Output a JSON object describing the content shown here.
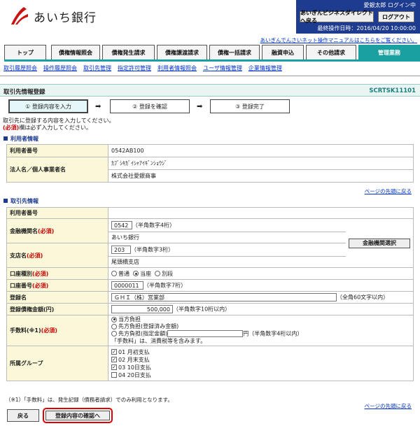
{
  "header": {
    "bank_name": "あいち銀行",
    "user": "愛銀太郎 ログイン中",
    "direct_button": "あいぎんビジネスダイレクトへ戻る",
    "logout_button": "ログアウト",
    "last_operation": "最終操作日時：2016/04/20 10:00:00",
    "manual_link": "あいぎんでんさいネット操作マニュアルはこちらをご覧ください。"
  },
  "tabs": [
    "トップ",
    "債権情報照会",
    "債権発生請求",
    "債権譲渡請求",
    "債権一括請求",
    "融資申込",
    "その他請求",
    "管理業務"
  ],
  "subnav": [
    "取引履歴照会",
    "操作履歴照会",
    "取引先管理",
    "指定許可管理",
    "利用者情報照会",
    "ユーザ情報管理",
    "企業情報管理"
  ],
  "title": {
    "text": "取引先情報登録",
    "code": "SCRTSK11101"
  },
  "steps": [
    "① 登録内容を入力",
    "② 登録を確認",
    "③ 登録完了"
  ],
  "intro": {
    "line1": "取引先に登録する内容を入力してください。",
    "req": "(必須)",
    "line2": "欄は必ず入力してください。"
  },
  "section_user": "利用者情報",
  "user_info": {
    "number_label": "利用者番号",
    "number": "0542AB100",
    "name_label": "法人名／個人事業者名",
    "name_kana": "ｶﾌﾞｼｷｶﾞｲｼｬｱｲｷﾞﾝｼｮｳｼﾞ",
    "name": "株式会社愛銀商事"
  },
  "page_top": "ページの先頭に戻る",
  "section_partner": "取引先情報",
  "partner": {
    "number_label": "利用者番号",
    "bank_label": "金融機関名",
    "bank_code": "0542",
    "bank_code_hint": "（半角数字4桁）",
    "bank_name": "あいち銀行",
    "bank_select": "金融機関選択",
    "branch_label": "支店名",
    "branch_code": "203",
    "branch_code_hint": "（半角数字3桁）",
    "branch_name": "尾頭橋支店",
    "account_type_label": "口座種別",
    "account_types": [
      "普通",
      "当座",
      "別段"
    ],
    "account_no_label": "口座番号",
    "account_no": "0000011",
    "account_no_hint": "（半角数字7桁）",
    "reg_name_label": "登録名",
    "reg_name": "ＧＨＩ（株）営業部",
    "reg_name_hint": "（全角60文字以内）",
    "limit_label": "登録債権金額(円)",
    "limit": "500,000",
    "limit_hint": "（半角数字10桁以内）",
    "fee_label": "手数料(※1)",
    "fee_opt1": "当方負担",
    "fee_opt2": "先方負担(登録済み金額)",
    "fee_opt3": "先方負担(指定金額)",
    "fee_hint": "円（半角数字4桁以内）",
    "fee_note": "「手数料」は、消費税等を含みます。",
    "group_label": "所属グループ",
    "groups": [
      "01 月初支払",
      "02 月末支払",
      "03 10日支払",
      "04 20日支払"
    ]
  },
  "required": "(必須)",
  "footnote": "（※1）「手数料」は、発生記録（債務者請求）でのみ利用となります。",
  "buttons": {
    "back": "戻る",
    "confirm": "登録内容の確認へ"
  }
}
